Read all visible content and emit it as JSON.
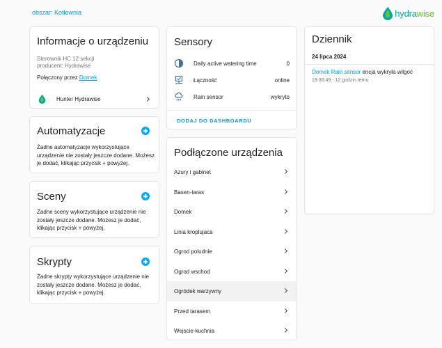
{
  "area": {
    "link_label": "obszar: Kotłownia"
  },
  "logo": {
    "word_part1": "hydra",
    "word_part2": "wise"
  },
  "device_info": {
    "title": "Informacje o urządzeniu",
    "model": "Sterownik HC 12 sekcji",
    "producer": "producent: Hydrawise",
    "connected_prefix": "Połączony przez ",
    "connected_link": "Domek",
    "integration": "Hunter Hydrawise"
  },
  "automations": {
    "title": "Automatyzacje",
    "body": "Żadne automatyzacje wykorzystujące urządzenie nie zostały jeszcze dodane. Możesz je dodać, klikając przycisk + powyżej."
  },
  "scenes": {
    "title": "Sceny",
    "body": "Żadne sceny wykorzystujące urządzenie nie zostały jeszcze dodane. Możesz je dodać, klikając przycisk + powyżej."
  },
  "scripts": {
    "title": "Skrypty",
    "body": "Żadne skrypty wykorzystujące urządzenie nie zostały jeszcze dodane. Możesz je dodać, klikając przycisk + powyżej."
  },
  "sensors": {
    "title": "Sensory",
    "items": [
      {
        "name": "Daily active watering time",
        "value": "0",
        "icon": "timer-icon"
      },
      {
        "name": "Łączność",
        "value": "online",
        "icon": "connectivity-icon"
      },
      {
        "name": "Rain sensor",
        "value": "wykryto",
        "icon": "rain-cloud-icon"
      }
    ],
    "add_to_dashboard": "DODAJ DO DASHBOARDU"
  },
  "connected_devices": {
    "title": "Podłączone urządzenia",
    "items": [
      "Azury i gabinet",
      "Basen-taras",
      "Domek",
      "Linia kroplujaca",
      "Ogrod poludnie",
      "Ogrod wschod",
      "Ogródek warzywny",
      "Przed tarasem",
      "Wejscie-kuchnia"
    ],
    "highlighted_index": 6
  },
  "log": {
    "title": "Dziennik",
    "date": "24 lipca 2024",
    "entry_link": "Domek Rain sensor",
    "entry_text": " encja wykryła wilgoć",
    "entry_time": "19:36:49 - 12 godzin temu"
  },
  "colors": {
    "accent": "#03a9f4",
    "link": "#039be5",
    "brand_teal": "#00a9a0",
    "brand_green": "#6bbf3a"
  }
}
